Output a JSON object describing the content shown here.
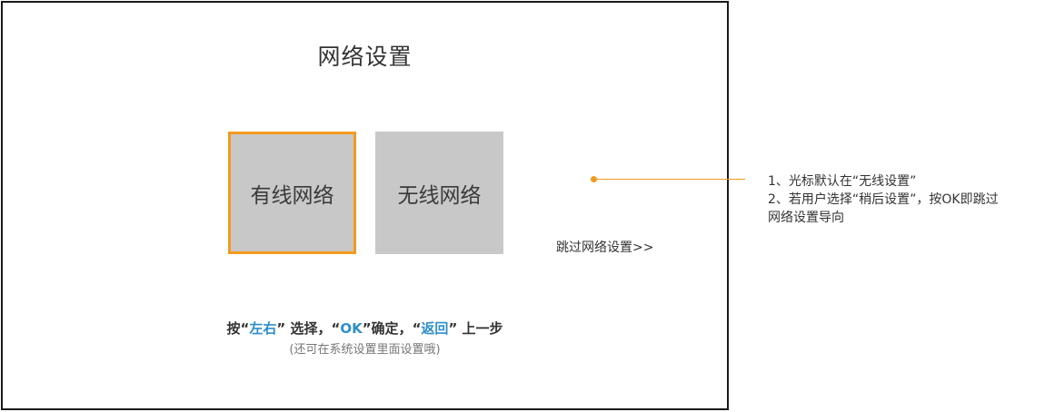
{
  "screen": {
    "title": "网络设置",
    "options": [
      {
        "label": "有线网络",
        "selected": true
      },
      {
        "label": "无线网络",
        "selected": false
      }
    ],
    "skip_label": "跳过网络设置>>",
    "hint": {
      "prefix": "按",
      "q_open_1": "“",
      "key_1": "左右",
      "q_close_1": "”",
      "text_1": "选择，",
      "q_open_2": "“",
      "key_2": "OK",
      "q_close_2": "”",
      "text_2": "确定，",
      "q_open_3": "“",
      "key_3": "返回",
      "q_close_3": "”",
      "text_3": "上一步"
    },
    "subhint": "(还可在系统设置里面设置哦)"
  },
  "annotation": {
    "line_1": "1、光标默认在“无线设置”",
    "line_2": "2、若用户选择“稍后设置”，按OK即跳过",
    "line_3": "网络设置导向"
  },
  "colors": {
    "selection_border": "#f39a1e",
    "key_highlight": "#2e8fc9",
    "option_background": "#c8c8c8"
  }
}
